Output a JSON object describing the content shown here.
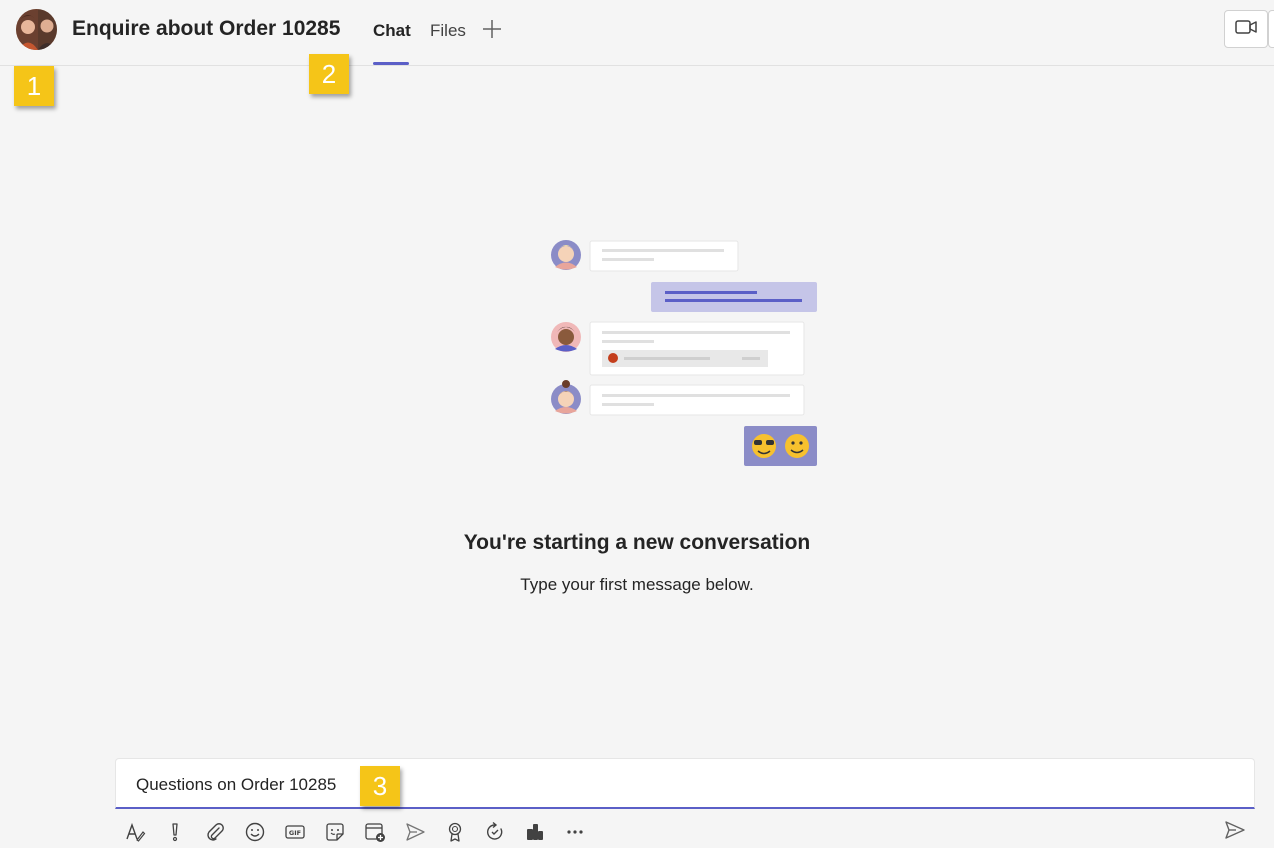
{
  "header": {
    "title": "Enquire about Order 10285",
    "tabs": [
      {
        "label": "Chat",
        "active": true
      },
      {
        "label": "Files",
        "active": false
      }
    ],
    "add_tab_icon": "plus-icon",
    "video_icon": "video-camera-icon"
  },
  "callouts": [
    "1",
    "2",
    "3"
  ],
  "empty_state": {
    "title": "You're starting a new conversation",
    "subtitle": "Type your first message below."
  },
  "composer": {
    "value": "Questions on Order 10285"
  },
  "toolbar": {
    "icons": [
      "format-icon",
      "important-icon",
      "attach-icon",
      "emoji-icon",
      "gif-icon",
      "sticker-icon",
      "schedule-meeting-icon",
      "stream-icon",
      "praise-icon",
      "loop-icon",
      "app-icon",
      "more-options-icon"
    ],
    "send_icon": "send-icon"
  },
  "colors": {
    "accent": "#5b5fc7",
    "callout": "#f5c518",
    "background": "#f5f5f5"
  }
}
